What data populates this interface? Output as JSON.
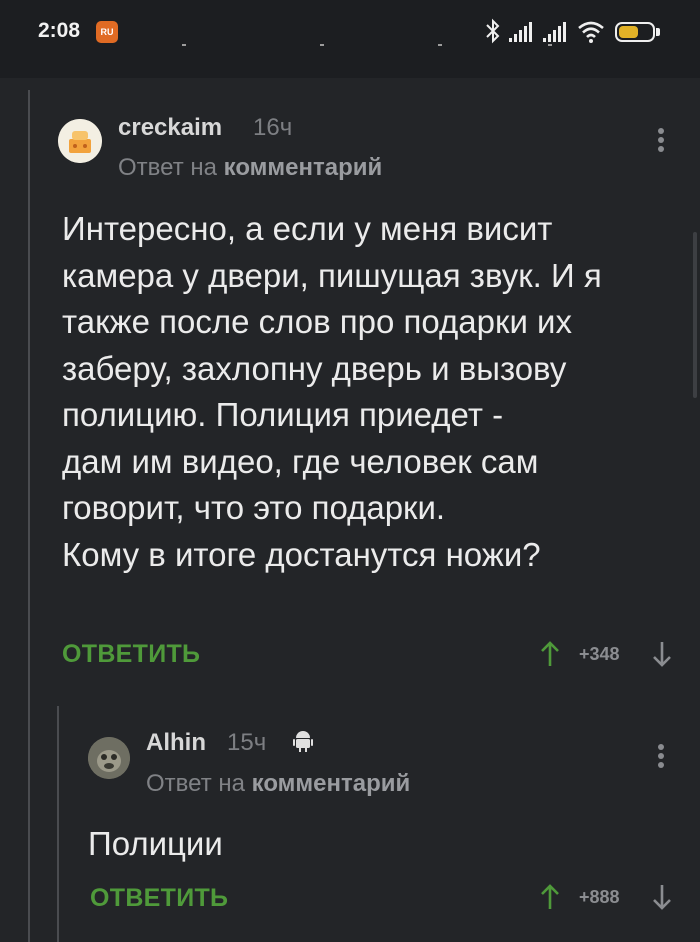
{
  "status_bar": {
    "time": "2:08",
    "app_icon_text": "RU",
    "battery_level": 0.6
  },
  "comments": [
    {
      "nick": "creckaim",
      "time": "16ч",
      "reply_prefix": "Ответ на",
      "reply_target": "комментарий",
      "text": "Интересно, а если у меня висит\nкамера у двери, пишущая звук. И я\nтакже после слов про подарки их\nзаберу, захлопну дверь и вызову\nполицию. Полиция приедет -\nдам им видео, где человек сам\nговорит, что это подарки.\nКому в итоге достанутся ножи?",
      "reply_label": "ОТВЕТИТЬ",
      "rating": "+348"
    },
    {
      "nick": "Alhin",
      "time": "15ч",
      "reply_prefix": "Ответ на",
      "reply_target": "комментарий",
      "text": "Полиции",
      "reply_label": "ОТВЕТИТЬ",
      "rating": "+888"
    }
  ],
  "icons": {
    "status": [
      "app-notification-icon",
      "bluetooth-icon",
      "signal-icon",
      "signal-icon",
      "wifi-icon",
      "battery-icon"
    ],
    "comment": [
      "more-options-icon",
      "upvote-arrow-icon",
      "downvote-arrow-icon",
      "android-icon"
    ]
  },
  "colors": {
    "background": "#232528",
    "reply_button": "#4f9a3a",
    "battery_fill": "#e2b227",
    "app_icon": "#e06b24"
  }
}
